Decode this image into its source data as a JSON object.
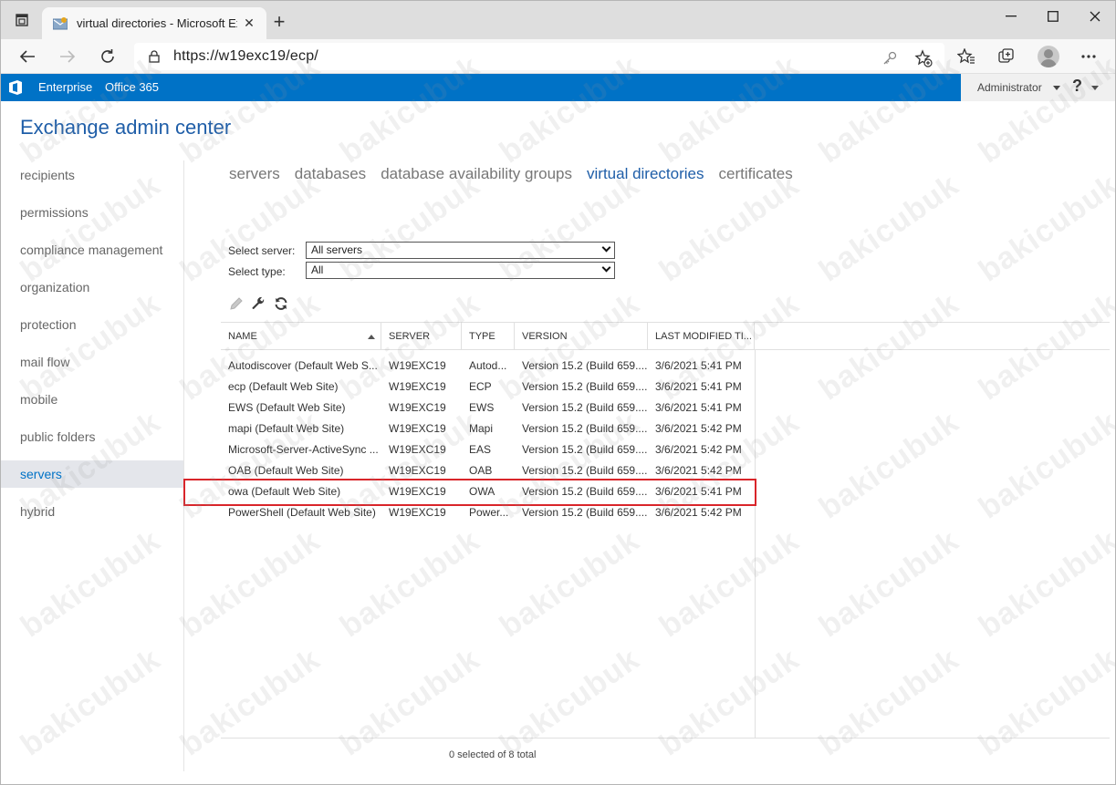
{
  "browser": {
    "tab_title": "virtual directories - Microsoft Exc",
    "url": "https://w19exc19/ecp/"
  },
  "o365": {
    "enterprise_label": "Enterprise",
    "office365_label": "Office 365",
    "user_label": "Administrator",
    "help_label": "?"
  },
  "page": {
    "title": "Exchange admin center"
  },
  "left_nav": [
    {
      "label": "recipients"
    },
    {
      "label": "permissions"
    },
    {
      "label": "compliance management"
    },
    {
      "label": "organization"
    },
    {
      "label": "protection"
    },
    {
      "label": "mail flow"
    },
    {
      "label": "mobile"
    },
    {
      "label": "public folders"
    },
    {
      "label": "servers"
    },
    {
      "label": "hybrid"
    }
  ],
  "sub_tabs": [
    {
      "label": "servers"
    },
    {
      "label": "databases"
    },
    {
      "label": "database availability groups"
    },
    {
      "label": "virtual directories"
    },
    {
      "label": "certificates"
    }
  ],
  "filters": {
    "server_label": "Select server:",
    "server_value": "All servers",
    "type_label": "Select type:",
    "type_value": "All"
  },
  "toolbar": {
    "edit_icon": "pencil-icon",
    "configure_icon": "wrench-icon",
    "refresh_icon": "refresh-icon"
  },
  "grid": {
    "columns": [
      "NAME",
      "SERVER",
      "TYPE",
      "VERSION",
      "LAST MODIFIED TI..."
    ],
    "rows": [
      [
        "Autodiscover (Default Web S...",
        "W19EXC19",
        "Autod...",
        "Version 15.2 (Build 659....",
        "3/6/2021 5:41 PM"
      ],
      [
        "ecp (Default Web Site)",
        "W19EXC19",
        "ECP",
        "Version 15.2 (Build 659....",
        "3/6/2021 5:41 PM"
      ],
      [
        "EWS (Default Web Site)",
        "W19EXC19",
        "EWS",
        "Version 15.2 (Build 659....",
        "3/6/2021 5:41 PM"
      ],
      [
        "mapi (Default Web Site)",
        "W19EXC19",
        "Mapi",
        "Version 15.2 (Build 659....",
        "3/6/2021 5:42 PM"
      ],
      [
        "Microsoft-Server-ActiveSync ...",
        "W19EXC19",
        "EAS",
        "Version 15.2 (Build 659....",
        "3/6/2021 5:42 PM"
      ],
      [
        "OAB (Default Web Site)",
        "W19EXC19",
        "OAB",
        "Version 15.2 (Build 659....",
        "3/6/2021 5:42 PM"
      ],
      [
        "owa (Default Web Site)",
        "W19EXC19",
        "OWA",
        "Version 15.2 (Build 659....",
        "3/6/2021 5:41 PM"
      ],
      [
        "PowerShell (Default Web Site)",
        "W19EXC19",
        "Power...",
        "Version 15.2 (Build 659....",
        "3/6/2021 5:42 PM"
      ]
    ],
    "status": "0 selected of 8 total"
  },
  "watermark_text": "bakicubuk",
  "colors": {
    "brand_blue": "#0072c6",
    "title_blue": "#1f5ea8",
    "highlight_red": "#d9252a"
  }
}
